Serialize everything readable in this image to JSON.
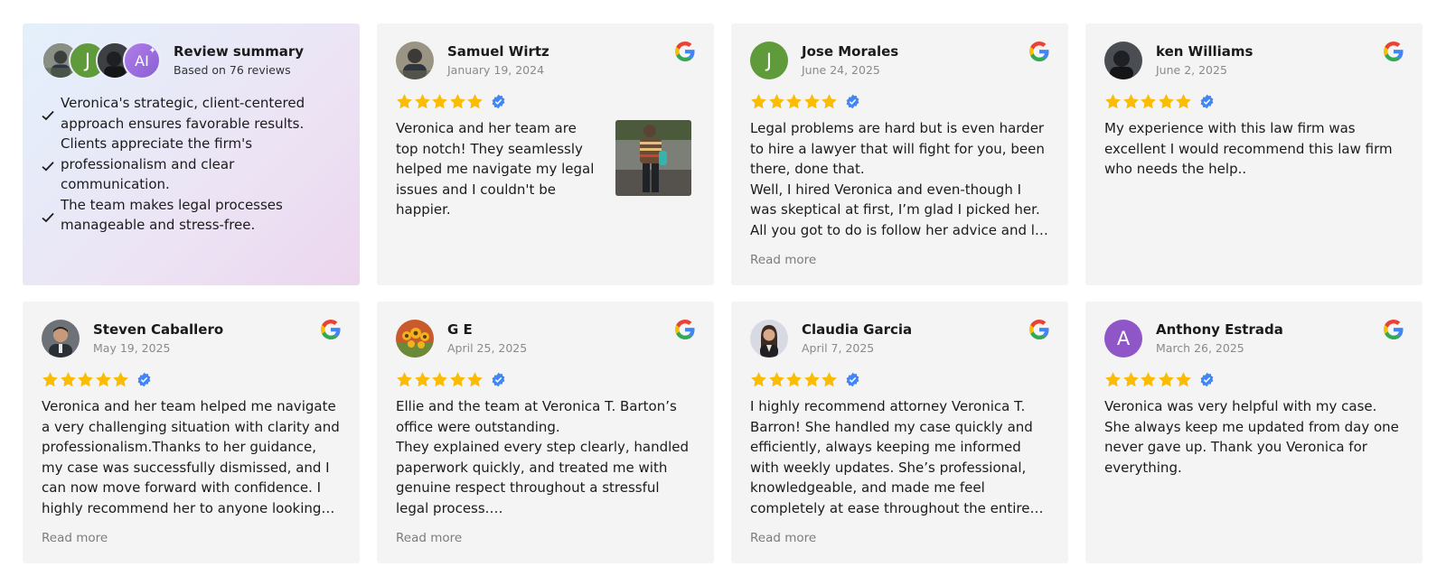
{
  "summary": {
    "title": "Review summary",
    "subtitle": "Based on 76 reviews",
    "avatars": [
      {
        "kind": "photo",
        "color": "#5a5f66"
      },
      {
        "kind": "letter",
        "letter": "J",
        "color": "#5f9b3a"
      },
      {
        "kind": "photo",
        "color": "#2a2e33"
      },
      {
        "kind": "ai",
        "letter": "AI",
        "color": "#9b6fd9"
      }
    ],
    "bullets": [
      "Veronica's strategic, client-centered approach ensures favorable results.",
      "Clients appreciate the firm's professionalism and clear communication.",
      "The team makes legal processes manageable and stress-free."
    ]
  },
  "read_more_label": "Read more",
  "colors": {
    "star": "#fbbc04",
    "verified": "#4285f4",
    "card_bg": "#f4f4f4"
  },
  "reviews": [
    {
      "name": "Samuel Wirtz",
      "date": "January 19, 2024",
      "rating": 5,
      "text": "Veronica and her team are top notch! They seamlessly helped me navigate my legal issues and I couldn't be happier.",
      "avatar_color": "#6f6a5e",
      "has_photo": true,
      "read_more": false
    },
    {
      "name": "Jose Morales",
      "date": "June 24, 2025",
      "rating": 5,
      "text": "Legal problems are hard but is even harder to hire a lawyer that will fight for you, been there, done that.\nWell, I hired Veronica and even-though I was skeptical at first, I’m glad I picked her. All you got to do is follow her advice and let her do…",
      "avatar_letter": "J",
      "avatar_color": "#5f9b3a",
      "read_more": true
    },
    {
      "name": "ken Williams",
      "date": "June 2, 2025",
      "rating": 5,
      "text": "My experience with this law firm was excellent I would recommend this law firm who needs the help..",
      "avatar_color": "#2a2e33",
      "read_more": false
    },
    {
      "name": "Steven Caballero",
      "date": "May 19, 2025",
      "rating": 5,
      "text": "Veronica and her team helped me navigate a very challenging situation with clarity and professionalism.Thanks to her guidance, my case was successfully dismissed, and I can now move forward with confidence. I highly recommend her to anyone looking for…",
      "avatar_color": "#4a4f57",
      "read_more": true
    },
    {
      "name": "G E",
      "date": "April 25, 2025",
      "rating": 5,
      "text": "Ellie and the team at Veronica T. Barton’s office were outstanding.\nThey explained every step clearly, handled paperwork quickly, and treated me with genuine respect throughout a stressful legal process.…",
      "avatar_color": "#d9652f",
      "read_more": true
    },
    {
      "name": "Claudia Garcia",
      "date": "April 7, 2025",
      "rating": 5,
      "text": "I highly recommend attorney Veronica T. Barron! She handled my case quickly and efficiently, always keeping me informed with weekly updates. She’s professional, knowledgeable, and made me feel completely at ease throughout the entire…",
      "avatar_color": "#c9ccd6",
      "read_more": true
    },
    {
      "name": "Anthony Estrada",
      "date": "March 26, 2025",
      "rating": 5,
      "text": "Veronica was very helpful with my case. She always keep me updated from day one never gave up. Thank you Veronica for everything.",
      "avatar_letter": "A",
      "avatar_color": "#8e56c7",
      "read_more": false
    }
  ]
}
